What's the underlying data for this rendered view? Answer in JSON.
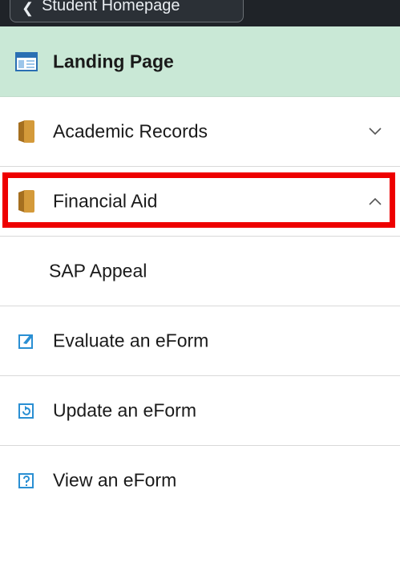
{
  "topbar": {
    "back_label": "Student Homepage"
  },
  "menu": {
    "items": [
      {
        "label": "Landing Page"
      },
      {
        "label": "Academic Records"
      },
      {
        "label": "Financial Aid"
      },
      {
        "label": "SAP Appeal"
      },
      {
        "label": "Evaluate an eForm"
      },
      {
        "label": "Update an eForm"
      },
      {
        "label": "View an eForm"
      }
    ]
  },
  "colors": {
    "landing_bg": "#c9e8d6",
    "highlight": "#ee0000",
    "folder": "#c68a2e",
    "eform_icon": "#2a8fd3",
    "topbar": "#1f2328"
  },
  "icons": {
    "landing": "page-window-icon",
    "folder": "folder-icon",
    "evaluate": "edit-form-icon",
    "update": "refresh-form-icon",
    "view": "help-form-icon",
    "expand": "chevron-down-icon",
    "collapse": "chevron-up-icon"
  }
}
